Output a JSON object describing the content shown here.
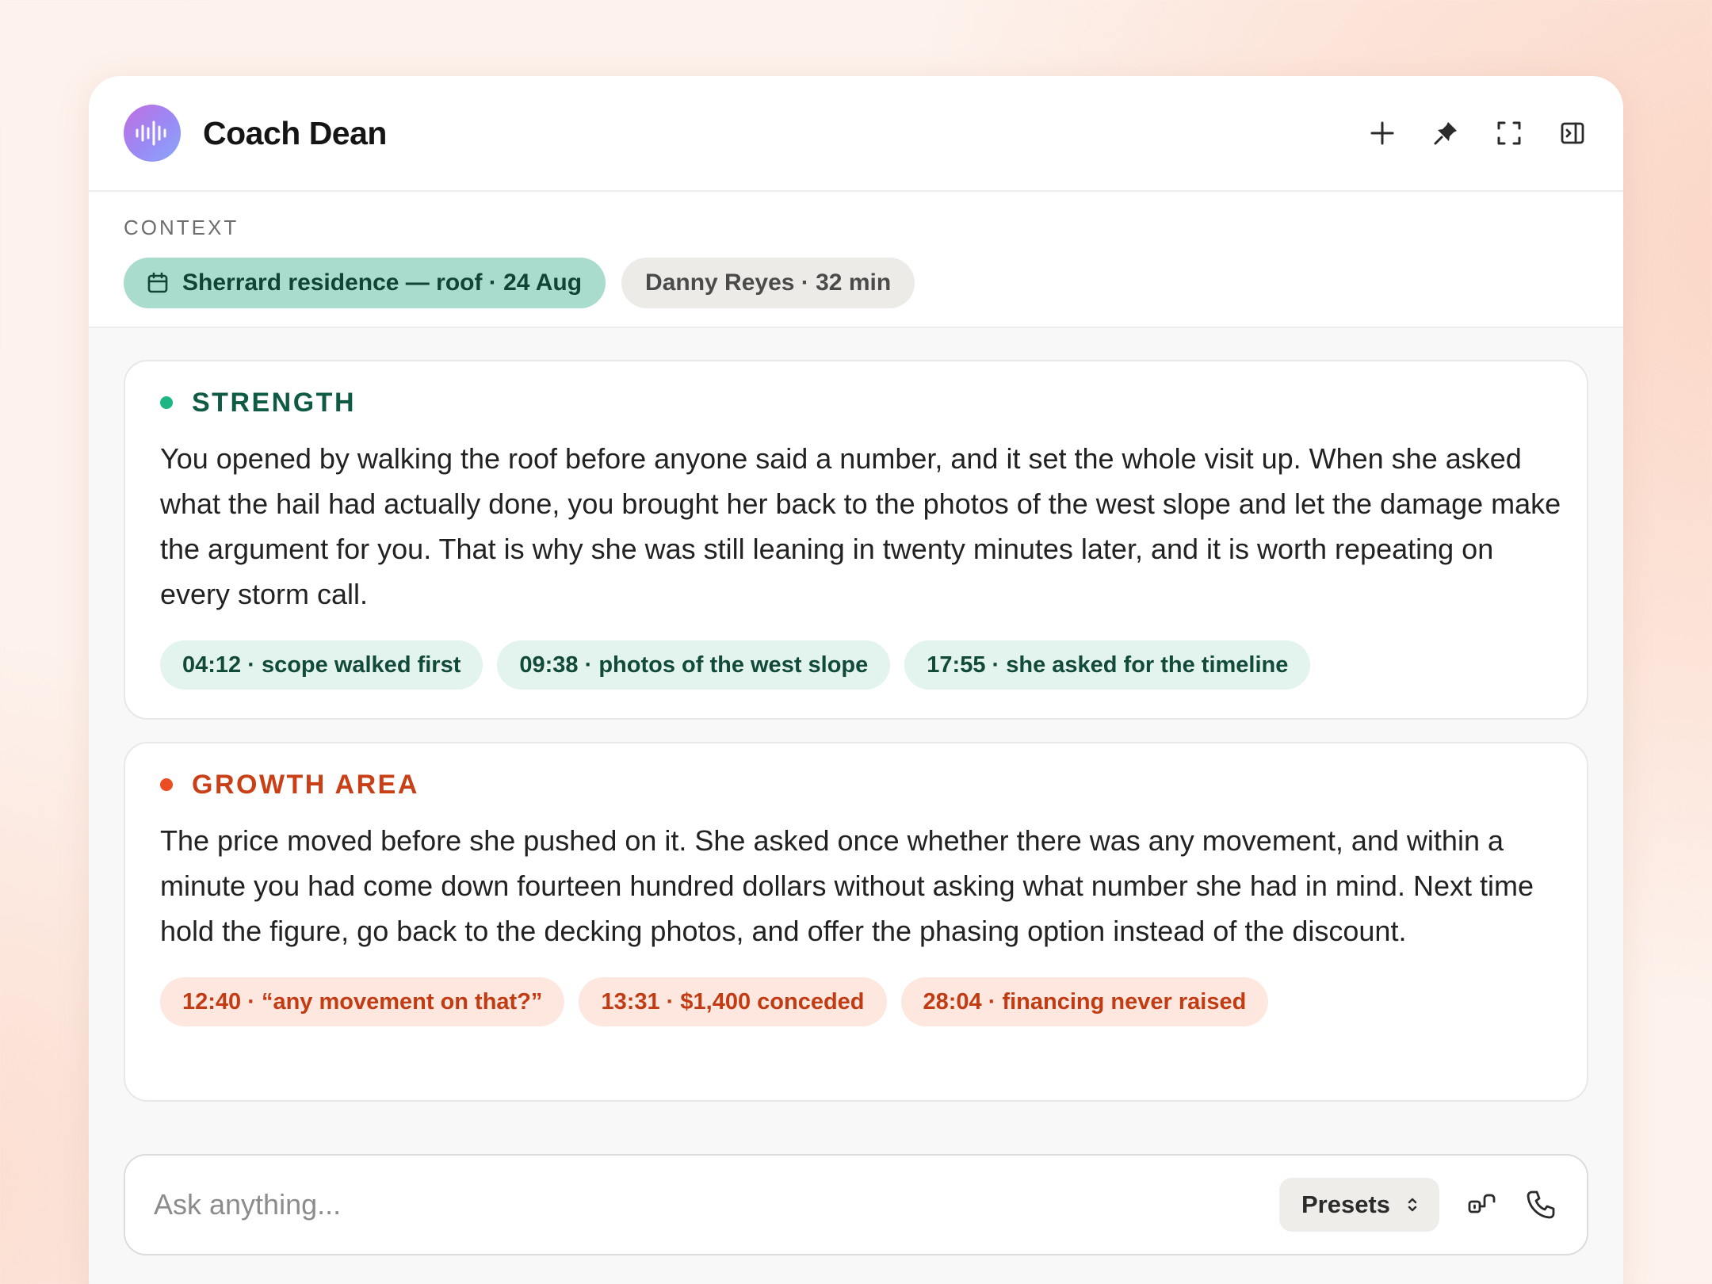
{
  "header": {
    "title": "Coach Dean",
    "logo_icon": "waveform-icon",
    "actions": [
      "plus-icon",
      "pin-icon",
      "expand-icon",
      "sidebar-toggle-icon"
    ]
  },
  "context": {
    "label": "CONTEXT",
    "chips": [
      {
        "label": "Sherrard residence — roof · 24 Aug",
        "icon": "calendar-icon"
      },
      {
        "label": "Danny Reyes · 32 min"
      }
    ]
  },
  "strength": {
    "title": "STRENGTH",
    "body": "You opened by walking the roof before anyone said a number, and it set the whole visit up. When she asked what the hail had actually done, you brought her back to the photos of the west slope and let the damage make the argument for you. That is why she was still leaning in twenty minutes later, and it is worth repeating on every storm call.",
    "tags": [
      "04:12 · scope walked first",
      "09:38 · photos of the west slope",
      "17:55 · she asked for the timeline"
    ],
    "color": "#1db584"
  },
  "growth": {
    "title": "GROWTH AREA",
    "body": "The price moved before she pushed on it. She asked once whether there was any movement, and within a minute you had come down fourteen hundred dollars without asking what number she had in mind. Next time hold the figure, go back to the decking photos, and offer the phasing option instead of the discount.",
    "tags": [
      "12:40 · “any movement on that?”",
      "13:31 · $1,400 conceded",
      "28:04 · financing never raised"
    ],
    "color": "#ec4c21"
  },
  "composer": {
    "placeholder": "Ask anything...",
    "presets_label": "Presets",
    "icons": [
      "link-icon",
      "phone-icon"
    ]
  }
}
